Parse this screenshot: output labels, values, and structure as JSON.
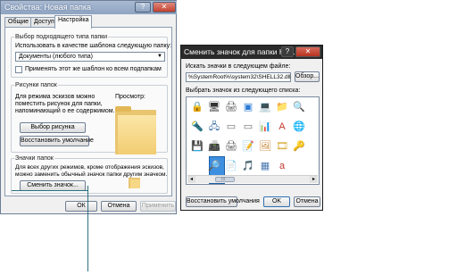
{
  "properties": {
    "title": "Свойства: Новая папка",
    "help_button": "?",
    "close_button": "✕",
    "tabs": [
      "Общие",
      "Доступ",
      "Настройка"
    ],
    "template_group": {
      "label": "Выбор подходящего типа папки",
      "use_template_label": "Использовать в качестве шаблона следующую папку:",
      "template_value": "Документы (любого типа)",
      "apply_subfolders_label": "Применять этот же шаблон ко всем подпапкам"
    },
    "pictures_group": {
      "label": "Рисунки папок",
      "description": [
        "Для режима эскизов можно",
        "поместить рисунок для папки,",
        "напоминающий о ее содержимом."
      ],
      "preview_label": "Просмотр:",
      "choose_button": "Выбор рисунка",
      "restore_button": "Восстановить умолчание"
    },
    "icons_group": {
      "label": "Значки папок",
      "description": [
        "Для всех других режимов, кроме отображения эскизов,",
        "можно заменить обычный значок папки другим значком."
      ],
      "change_icon_button": "Сменить значок..."
    },
    "footer": {
      "ok": "ОК",
      "cancel": "Отмена",
      "apply": "Применить"
    }
  },
  "icon_dialog": {
    "title": "Сменить значок для папки Но...",
    "help_button": "?",
    "close_button": "✕",
    "search_label": "Искать значки в следующем файле:",
    "file_path": "%SystemRoot%\\system32\\SHELL32.dll",
    "browse_button": "Обзор...",
    "choose_label": "Выбрать значок из следующего списка:",
    "scroll_left": "◂",
    "scroll_right": "▸",
    "thumb_label": "III",
    "footer": {
      "restore": "Восстановить умолчания",
      "ok": "OK",
      "cancel": "Отмена"
    }
  },
  "icons": [
    "lock-icon",
    "monitor-icon",
    "printer-icon",
    "window-icon",
    "computer-icon",
    "folder-icon",
    "search-icon",
    "flashlight-icon",
    "network-icon",
    "hard-drive-icon",
    "hard-drive-icon",
    "chart-folder-icon",
    "font-icon",
    "globe-icon",
    "floppy-icon",
    "fax-icon",
    "printer-icon",
    "notepad-icon",
    "image-icon",
    "video-folder-icon",
    "key-icon",
    "selected-icon",
    "magnifier-icon",
    "document-icon",
    "music-folder-icon",
    "grid-icon",
    "font-a-icon"
  ]
}
